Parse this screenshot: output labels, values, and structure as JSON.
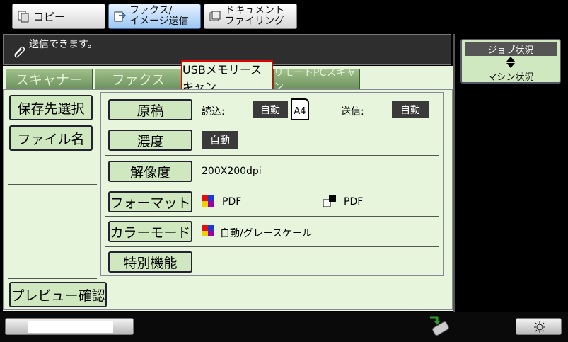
{
  "modes": {
    "copy_label": "コピー",
    "fax_line1": "ファクス/",
    "fax_line2": "イメージ送信",
    "doc_line1": "ドキュメント",
    "doc_line2": "ファイリング"
  },
  "message": "送信できます。",
  "job_status": {
    "top": "ジョブ状況",
    "bottom": "マシン状況"
  },
  "tabs": [
    {
      "label": "スキャナー",
      "active": false
    },
    {
      "label": "ファクス",
      "active": false
    },
    {
      "label": "USBメモリースキャン",
      "active": true
    },
    {
      "label": "リモートPCスキャン",
      "active": false
    }
  ],
  "side": {
    "save_dest": "保存先選択",
    "file_name": "ファイル名",
    "preview": "プレビュー確認"
  },
  "rows": {
    "original": {
      "label": "原稿",
      "read_label": "読込:",
      "read_value": "自動",
      "size": "A4",
      "send_label": "送信:",
      "send_value": "自動"
    },
    "density": {
      "label": "濃度",
      "value": "自動"
    },
    "resolution": {
      "label": "解像度",
      "value": "200X200dpi"
    },
    "format": {
      "label": "フォーマット",
      "color_value": "PDF",
      "bw_value": "PDF"
    },
    "color_mode": {
      "label": "カラーモード",
      "value": "自動/グレースケール"
    },
    "special": {
      "label": "特別機能"
    }
  }
}
